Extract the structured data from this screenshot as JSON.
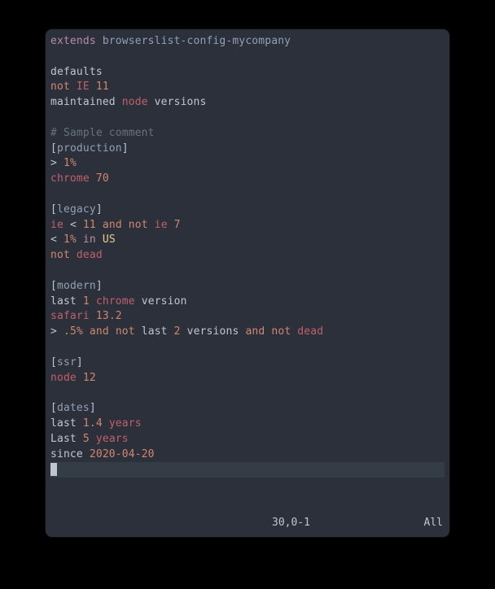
{
  "line1": {
    "extends": "extends",
    "sp": " ",
    "target": "browserslist-config-mycompany"
  },
  "line3": {
    "defaults": "defaults"
  },
  "line4": {
    "not": "not",
    "sp": " ",
    "ie": "IE",
    "sp2": " ",
    "num": "11"
  },
  "line5": {
    "maintained": "maintained",
    "sp": " ",
    "node": "node",
    "sp2": " ",
    "versions": "versions"
  },
  "line7": {
    "comment": "# Sample comment"
  },
  "line8": {
    "lb": "[",
    "name": "production",
    "rb": "]"
  },
  "line9": {
    "gt": ">",
    "sp": " ",
    "num": "1",
    "pct": "%"
  },
  "line10": {
    "chrome": "chrome",
    "sp": " ",
    "num": "70"
  },
  "line12": {
    "lb": "[",
    "name": "legacy",
    "rb": "]"
  },
  "line13": {
    "ie": "ie",
    "sp": " ",
    "lt": "<",
    "sp2": " ",
    "n1": "11",
    "sp3": " ",
    "and": "and",
    "sp4": " ",
    "not": "not",
    "sp5": " ",
    "ie2": "ie",
    "sp6": " ",
    "n2": "7"
  },
  "line14": {
    "lt": "<",
    "sp": " ",
    "num": "1",
    "pct": "%",
    "sp2": " ",
    "in": "in",
    "sp3": " ",
    "us": "US"
  },
  "line15": {
    "not": "not",
    "sp": " ",
    "dead": "dead"
  },
  "line17": {
    "lb": "[",
    "name": "modern",
    "rb": "]"
  },
  "line18": {
    "last": "last",
    "sp": " ",
    "num": "1",
    "sp2": " ",
    "chrome": "chrome",
    "sp3": " ",
    "version": "version"
  },
  "line19": {
    "safari": "safari",
    "sp": " ",
    "num": "13.2"
  },
  "line20": {
    "gt": ">",
    "sp": " ",
    "num": ".5",
    "pct": "%",
    "sp2": " ",
    "and1": "and",
    "sp3": " ",
    "not1": "not",
    "sp4": " ",
    "last": "last",
    "sp5": " ",
    "n2": "2",
    "sp6": " ",
    "versions": "versions",
    "sp7": " ",
    "and2": "and",
    "sp8": " ",
    "not2": "not",
    "sp9": " ",
    "dead": "dead"
  },
  "line22": {
    "lb": "[",
    "name": "ssr",
    "rb": "]"
  },
  "line23": {
    "node": "node",
    "sp": " ",
    "num": "12"
  },
  "line25": {
    "lb": "[",
    "name": "dates",
    "rb": "]"
  },
  "line26": {
    "last": "last",
    "sp": " ",
    "num": "1.4",
    "sp2": " ",
    "years": "years"
  },
  "line27": {
    "last": "Last",
    "sp": " ",
    "num": "5",
    "sp2": " ",
    "years": "years"
  },
  "line28": {
    "since": "since",
    "sp": " ",
    "date": "2020-04-20"
  },
  "status": {
    "position": "30,0-1",
    "scroll": "All"
  }
}
